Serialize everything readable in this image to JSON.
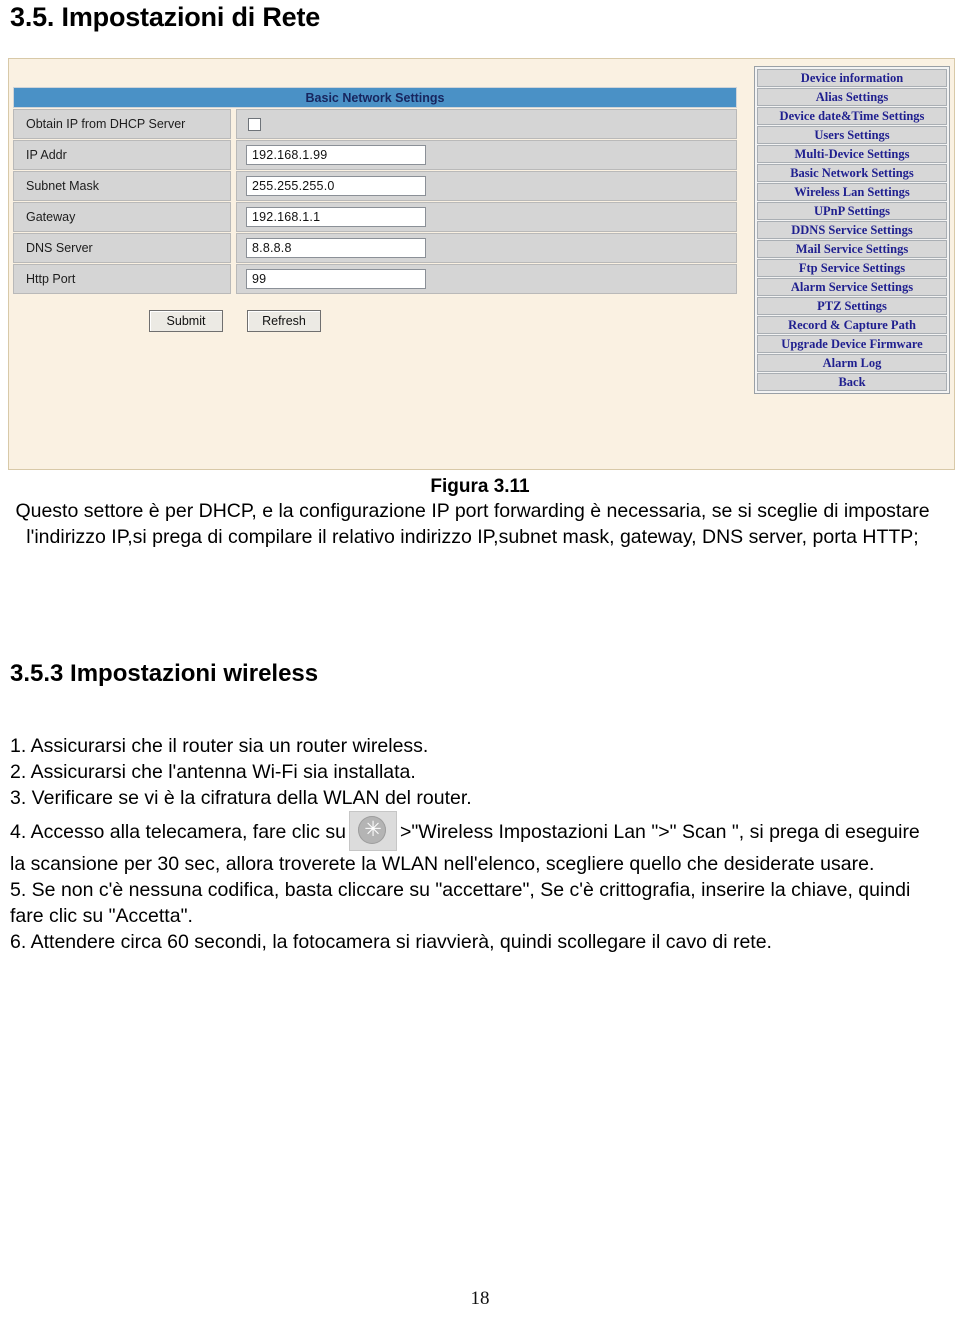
{
  "document": {
    "section_heading": "3.5. Impostazioni di Rete",
    "figure_caption": "Figura 3.11",
    "intro_paragraph": "Questo settore è per DHCP, e la configurazione IP port forwarding è necessaria, se si sceglie di impostare l'indirizzo IP,si prega di compilare il relativo indirizzo IP,subnet mask, gateway, DNS server, porta HTTP;",
    "subsection_heading": "3.5.3 Impostazioni wireless",
    "page_number": "18"
  },
  "steps": {
    "step1": "1. Assicurarsi che il router sia un router wireless.",
    "step2": "2. Assicurarsi che l'antenna Wi-Fi sia installata.",
    "step3": "3. Verificare se vi è la cifratura della WLAN del router.",
    "step4_before_icon": "4. Accesso alla telecamera, fare clic su",
    "step4_icon": "gear-settings-icon",
    "step4_after_icon": ">\"Wireless Impostazioni Lan \">\" Scan \", si prega di eseguire la scansione per 30 sec, allora troverete la WLAN nell'elenco, scegliere quello che desiderate usare.",
    "step5": "5. Se non c'è nessuna codifica, basta cliccare su \"accettare\", Se c'è crittografia, inserire la chiave, quindi fare clic su \"Accetta\".",
    "step6": "6. Attendere circa 60 secondi, la fotocamera si riavvierà, quindi scollegare il cavo di rete."
  },
  "screenshot": {
    "form": {
      "header_title": "Basic Network Settings",
      "rows": [
        {
          "label": "Obtain IP from DHCP Server",
          "type": "checkbox",
          "checked": false,
          "value": ""
        },
        {
          "label": "IP Addr",
          "type": "text",
          "value": "192.168.1.99"
        },
        {
          "label": "Subnet Mask",
          "type": "text",
          "value": "255.255.255.0"
        },
        {
          "label": "Gateway",
          "type": "text",
          "value": "192.168.1.1"
        },
        {
          "label": "DNS Server",
          "type": "text",
          "value": "8.8.8.8"
        },
        {
          "label": "Http Port",
          "type": "text",
          "value": "99"
        }
      ],
      "submit_label": "Submit",
      "refresh_label": "Refresh"
    },
    "menu": {
      "items": [
        {
          "label": "Device information"
        },
        {
          "label": "Alias Settings"
        },
        {
          "label": "Device date&Time Settings"
        },
        {
          "label": "Users Settings"
        },
        {
          "label": "Multi-Device Settings"
        },
        {
          "label": "Basic Network Settings"
        },
        {
          "label": "Wireless Lan Settings"
        },
        {
          "label": "UPnP Settings"
        },
        {
          "label": "DDNS Service Settings"
        },
        {
          "label": "Mail Service Settings"
        },
        {
          "label": "Ftp Service Settings"
        },
        {
          "label": "Alarm Service Settings"
        },
        {
          "label": "PTZ Settings"
        },
        {
          "label": "Record & Capture Path"
        },
        {
          "label": "Upgrade Device Firmware"
        },
        {
          "label": "Alarm Log"
        },
        {
          "label": "Back"
        }
      ]
    },
    "colors": {
      "header_bar": "#4a91c6",
      "panel_background": "#faf1e2",
      "menu_item_background": "#d7d7d7",
      "menu_item_text": "#1f1f8f",
      "label_background": "#d5d5d5"
    }
  }
}
